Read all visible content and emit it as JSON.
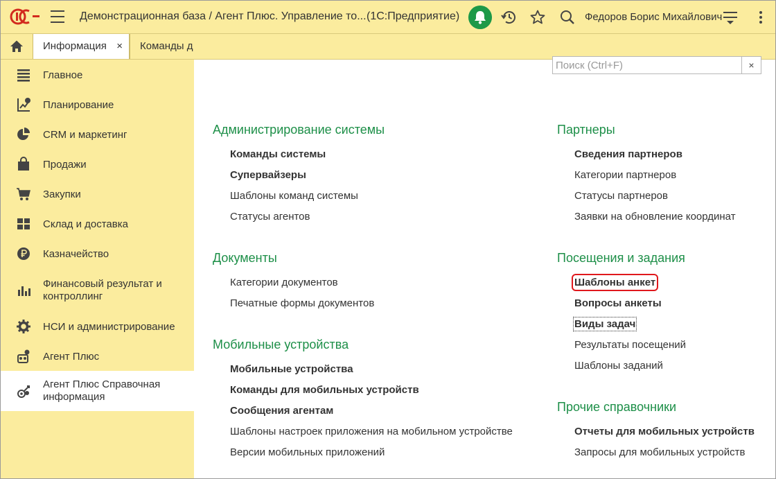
{
  "titlebar": {
    "title": "Демонстрационная база / Агент Плюс. Управление то...",
    "kind": "(1С:Предприятие)",
    "user": "Федоров Борис Михайлович",
    "logo_text": "1С"
  },
  "tabs": [
    {
      "label": "Информация",
      "close": "×"
    },
    {
      "label": "Команды д"
    }
  ],
  "sidebar": {
    "items": [
      {
        "label": "Главное"
      },
      {
        "label": "Планирование"
      },
      {
        "label": "CRM и маркетинг"
      },
      {
        "label": "Продажи"
      },
      {
        "label": "Закупки"
      },
      {
        "label": "Склад и доставка"
      },
      {
        "label": "Казначейство"
      },
      {
        "label": "Финансовый результат и\nконтроллинг"
      },
      {
        "label": "НСИ и администрирование"
      },
      {
        "label": "Агент Плюс"
      },
      {
        "label": "Агент Плюс Справочная\nинформация"
      }
    ]
  },
  "search": {
    "placeholder": "Поиск (Ctrl+F)",
    "clear": "×"
  },
  "sections": {
    "admin": {
      "title": "Администрирование системы",
      "links": [
        "Команды системы",
        "Супервайзеры",
        "Шаблоны команд системы",
        "Статусы агентов"
      ]
    },
    "docs": {
      "title": "Документы",
      "links": [
        "Категории документов",
        "Печатные формы документов"
      ]
    },
    "mobile": {
      "title": "Мобильные устройства",
      "links": [
        "Мобильные устройства",
        "Команды для мобильных устройств",
        "Сообщения агентам",
        "Шаблоны настроек приложения на мобильном устройстве",
        "Версии мобильных приложений"
      ]
    },
    "partners": {
      "title": "Партнеры",
      "links": [
        "Сведения партнеров",
        "Категории партнеров",
        "Статусы партнеров",
        "Заявки на обновление координат"
      ]
    },
    "visits": {
      "title": "Посещения и задания",
      "links": [
        "Шаблоны анкет",
        "Вопросы анкеты",
        "Виды задач",
        "Результаты посещений",
        "Шаблоны заданий"
      ]
    },
    "other": {
      "title": "Прочие справочники",
      "links": [
        "Отчеты для мобильных устройств",
        "Запросы для мобильных устройств"
      ]
    }
  },
  "colors": {
    "accent_yellow": "#fbec9e",
    "section_green": "#1d8f48",
    "bell_green": "#1d9948",
    "highlight_red": "#e0181c",
    "logo_red": "#d22a1e"
  },
  "icons": [
    "logo-1c",
    "burger-icon",
    "bell-icon",
    "history-icon",
    "star-icon",
    "search-icon",
    "menu-icon",
    "more-icon",
    "home-icon"
  ]
}
